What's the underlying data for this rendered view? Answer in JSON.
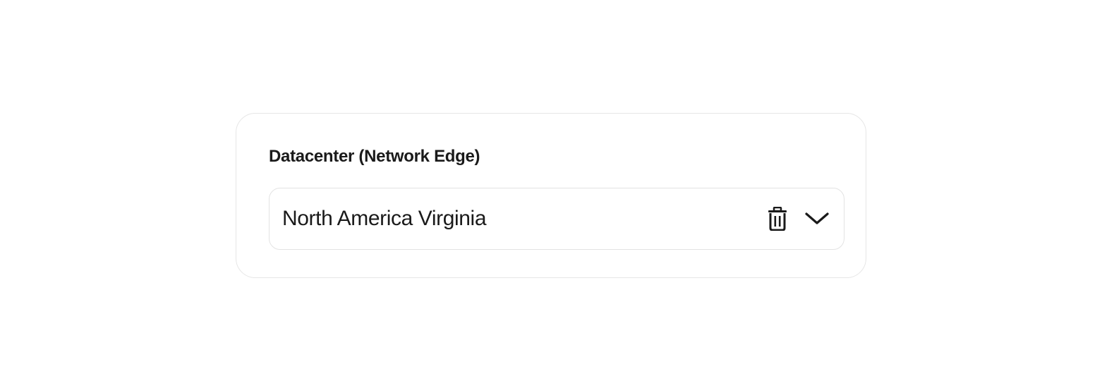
{
  "field": {
    "label": "Datacenter (Network Edge)",
    "selected_value": "North America Virginia"
  },
  "icons": {
    "clear": "trash-icon",
    "expand": "chevron-down-icon"
  },
  "colors": {
    "text": "#1a1a1a",
    "border": "#e3e3e3",
    "background": "#ffffff"
  }
}
